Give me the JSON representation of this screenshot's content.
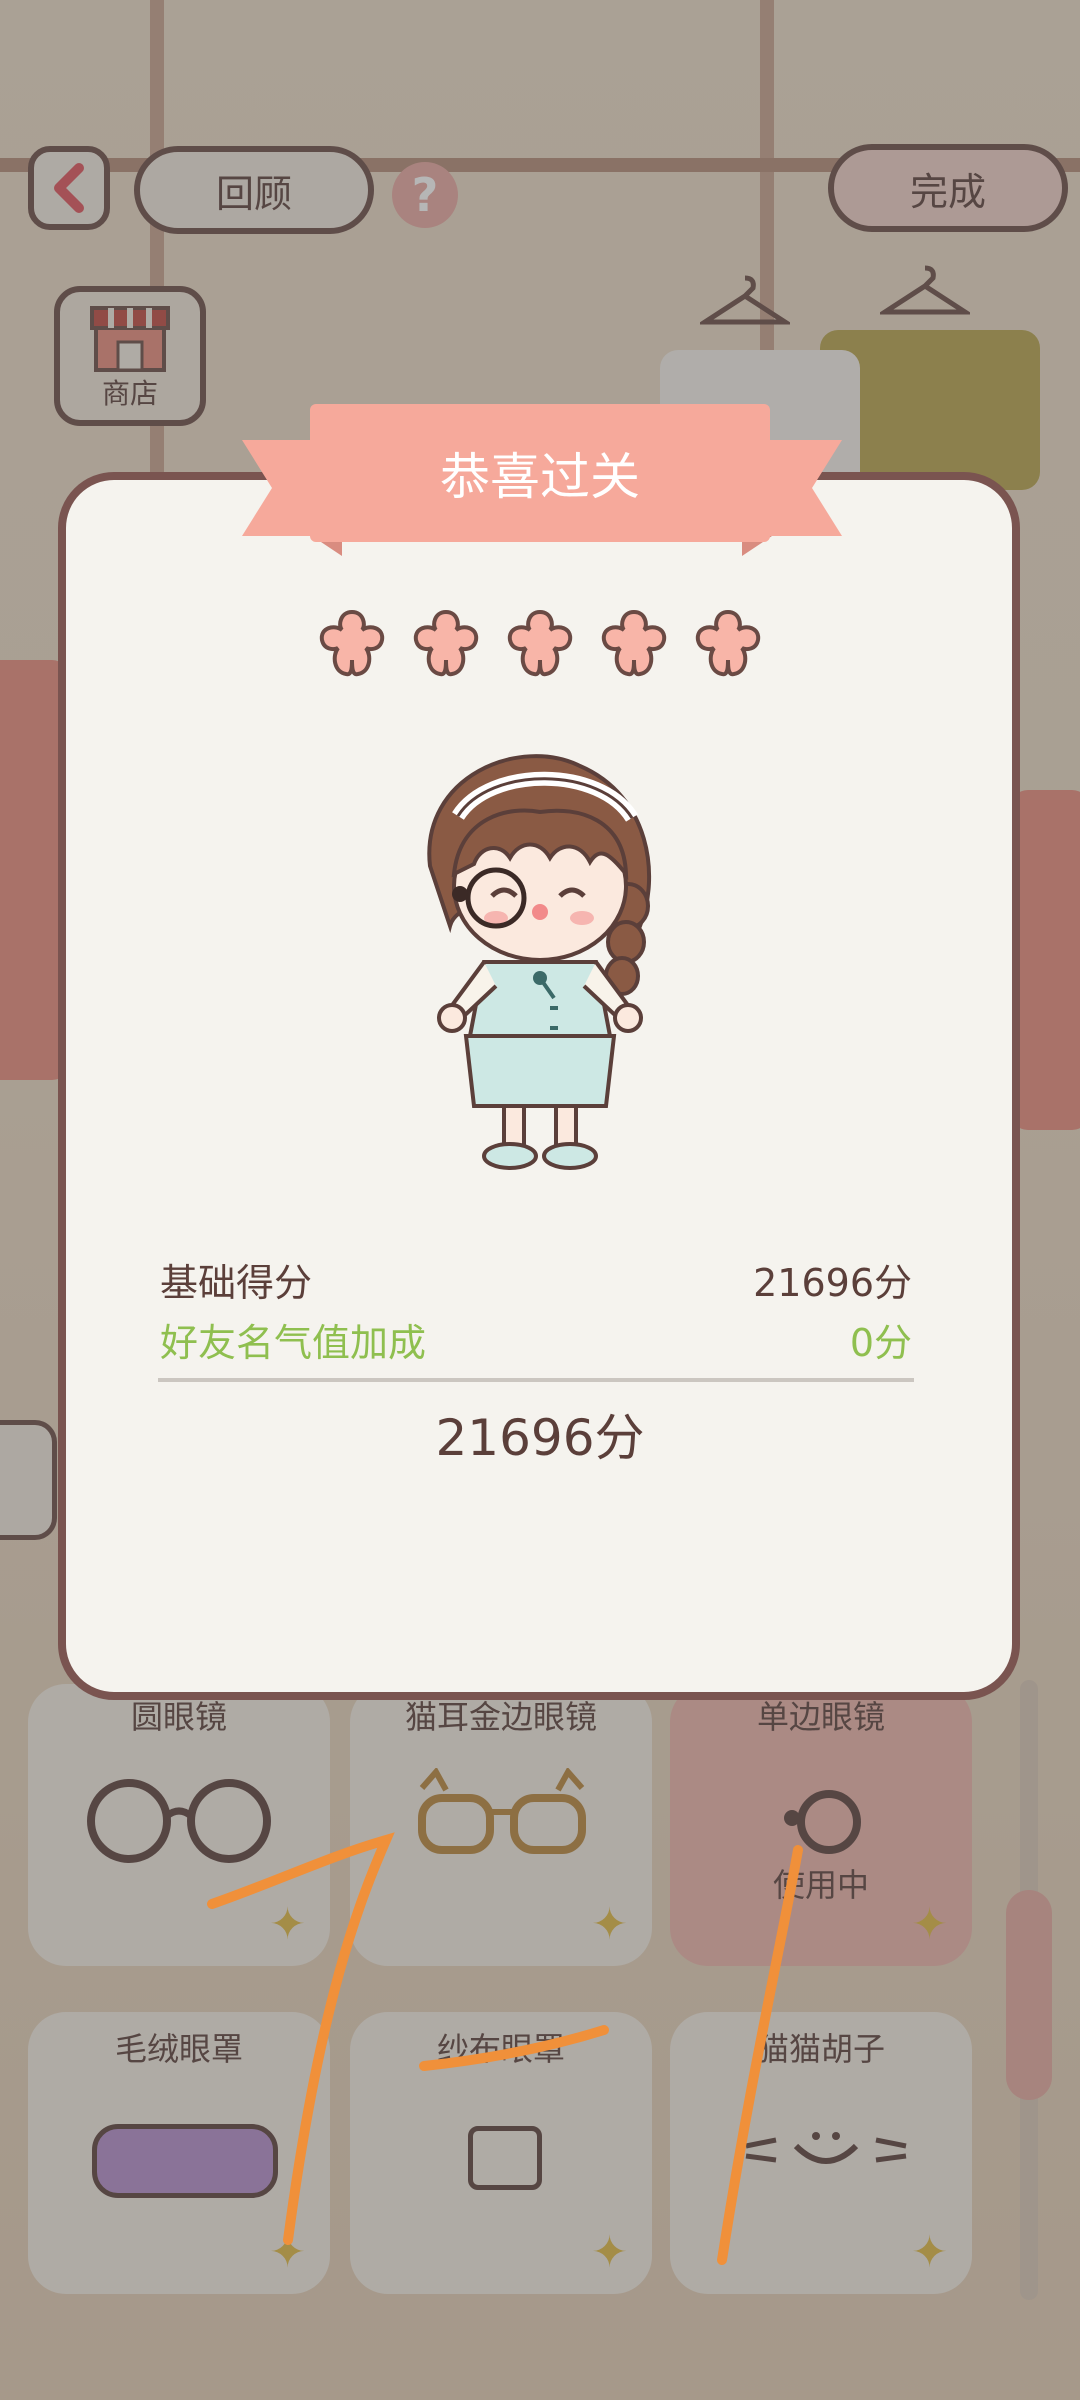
{
  "top_bar": {
    "review_label": "回顾",
    "help_symbol": "?",
    "done_label": "完成"
  },
  "shop": {
    "label": "商店"
  },
  "dialog": {
    "title": "恭喜过关",
    "stars": 5,
    "base_score_label": "基础得分",
    "base_score_value": "21696分",
    "bonus_label": "好友名气值加成",
    "bonus_value": "0分",
    "total": "21696分"
  },
  "items": [
    {
      "label": "圆眼镜",
      "used": false
    },
    {
      "label": "猫耳金边眼镜",
      "used": false
    },
    {
      "label": "单边眼镜",
      "used": true,
      "status": "使用中"
    },
    {
      "label": "毛绒眼罩",
      "used": false
    },
    {
      "label": "纱布眼罩",
      "used": false
    },
    {
      "label": "猫猫胡子",
      "used": false
    }
  ],
  "colors": {
    "accent_pink": "#f6a99b",
    "bonus_green": "#8fbf4f",
    "text_brown": "#5b3f3a",
    "frame_brown": "#7a5450"
  }
}
